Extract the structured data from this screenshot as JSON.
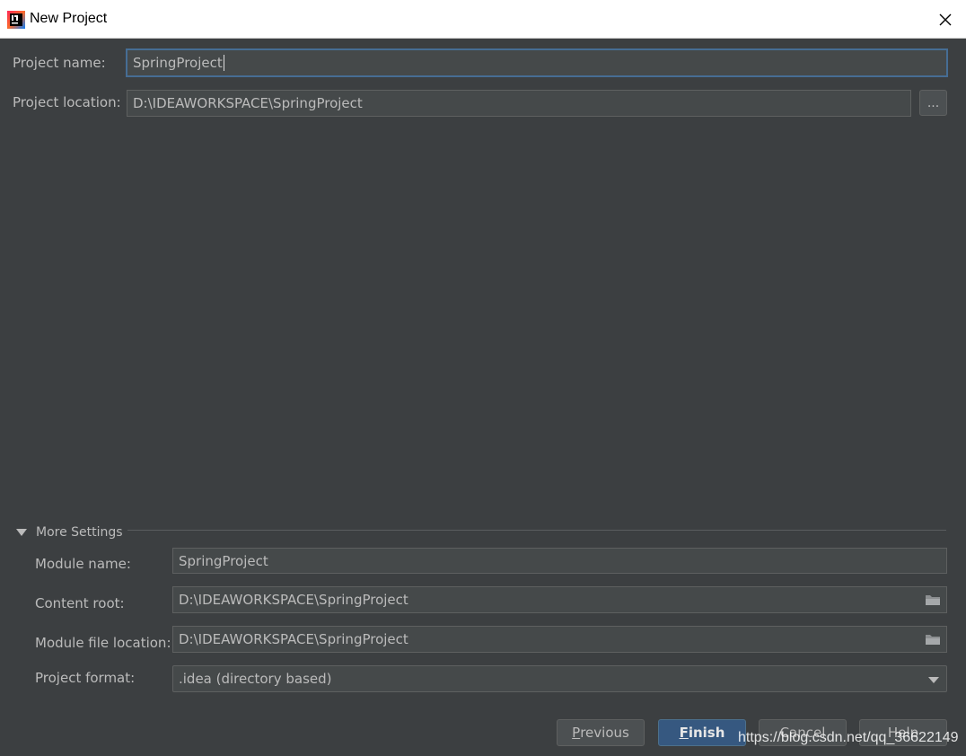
{
  "window": {
    "title": "New Project",
    "icon": "intellij-idea-icon",
    "close_icon": "close-icon"
  },
  "project": {
    "name_label": "Project name:",
    "name_value": "SpringProject",
    "location_label": "Project location:",
    "location_value": "D:\\IDEAWORKSPACE\\SpringProject",
    "browse_label": "..."
  },
  "more_settings": {
    "label": "More Settings",
    "expanded": true,
    "module_name_label": "Module name:",
    "module_name_value": "SpringProject",
    "content_root_label": "Content root:",
    "content_root_value": "D:\\IDEAWORKSPACE\\SpringProject",
    "module_file_label": "Module file location:",
    "module_file_value": "D:\\IDEAWORKSPACE\\SpringProject",
    "format_label": "Project format:",
    "format_value": ".idea (directory based)"
  },
  "buttons": {
    "previous": "Previous",
    "previous_mnemonic": "P",
    "previous_rest": "revious",
    "finish": "Finish",
    "finish_mnemonic": "F",
    "finish_rest": "inish",
    "cancel": "Cancel",
    "help": "Help"
  },
  "watermark": "https://blog.csdn.net/qq_36622149",
  "colors": {
    "background": "#3c3f41",
    "field_bg": "#45494a",
    "focus_border": "#466d94",
    "primary_button": "#365880",
    "text": "#bbbbbb"
  }
}
